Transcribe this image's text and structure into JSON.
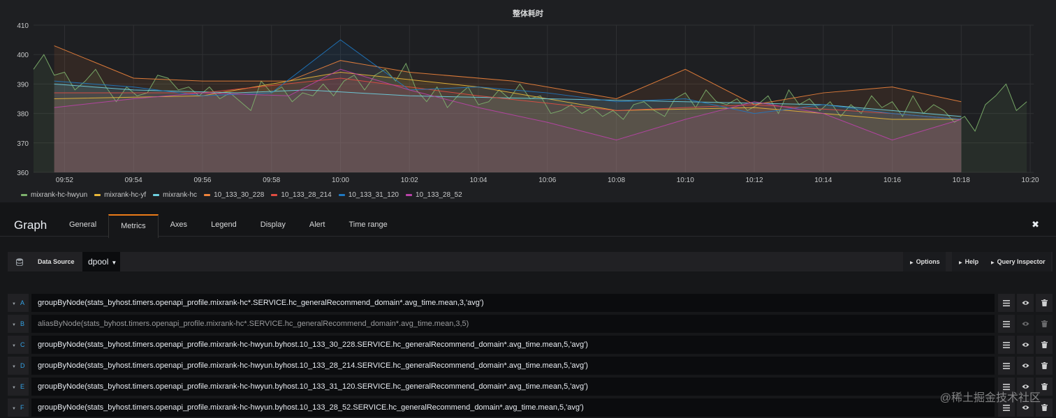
{
  "panel": {
    "title": "整体耗时"
  },
  "chart_data": {
    "type": "line",
    "title": "整体耗时",
    "ylim": [
      360,
      410
    ],
    "y_ticks": [
      "360",
      "370",
      "380",
      "390",
      "400",
      "410"
    ],
    "x_ticks": [
      "09:52",
      "09:54",
      "09:56",
      "09:58",
      "10:00",
      "10:02",
      "10:04",
      "10:06",
      "10:08",
      "10:10",
      "10:12",
      "10:14",
      "10:16",
      "10:18",
      "10:20"
    ],
    "x_range_minutes": [
      -8.9,
      20.1
    ],
    "grid": true,
    "legend_position": "bottom-left",
    "series": [
      {
        "name": "mixrank-hc-hwyun",
        "color": "#7eb26d",
        "x": [
          -8.9,
          -8.6,
          -8.3,
          -8.0,
          -7.7,
          -7.4,
          -7.1,
          -6.8,
          -6.5,
          -6.2,
          -5.9,
          -5.6,
          -5.3,
          -5.0,
          -4.7,
          -4.4,
          -4.1,
          -3.8,
          -3.5,
          -3.2,
          -2.9,
          -2.6,
          -2.3,
          -2.0,
          -1.7,
          -1.4,
          -1.1,
          -0.8,
          -0.5,
          -0.2,
          0.1,
          0.4,
          0.7,
          1.0,
          1.3,
          1.6,
          1.9,
          2.2,
          2.5,
          2.8,
          3.1,
          3.4,
          3.7,
          4.0,
          4.3,
          4.6,
          4.9,
          5.2,
          5.5,
          5.8,
          6.1,
          6.4,
          6.7,
          7.0,
          7.3,
          7.6,
          7.9,
          8.2,
          8.5,
          8.8,
          9.1,
          9.4,
          9.7,
          10.0,
          10.3,
          10.6,
          10.9,
          11.2,
          11.5,
          11.8,
          12.1,
          12.4,
          12.7,
          13.0,
          13.3,
          13.6,
          13.9,
          14.2,
          14.5,
          14.8,
          15.1,
          15.4,
          15.7,
          16.0,
          16.3,
          16.6,
          16.9,
          17.2,
          17.5,
          17.8,
          18.1,
          18.4,
          18.7,
          19.0,
          19.3,
          19.6,
          19.9
        ],
        "values": [
          395,
          400,
          393,
          394,
          388,
          391,
          395,
          389,
          384,
          389,
          386,
          387,
          393,
          392,
          388,
          389,
          386,
          389,
          385,
          387,
          384,
          381,
          391,
          387,
          389,
          384,
          387,
          386,
          390,
          386,
          391,
          393,
          388,
          393,
          395,
          391,
          397,
          388,
          384,
          389,
          382,
          386,
          389,
          383,
          384,
          388,
          385,
          390,
          385,
          386,
          380,
          381,
          383,
          380,
          382,
          379,
          381,
          378,
          383,
          384,
          381,
          379,
          385,
          387,
          382,
          388,
          384,
          383,
          385,
          381,
          383,
          386,
          380,
          388,
          383,
          385,
          381,
          384,
          379,
          383,
          380,
          386,
          382,
          384,
          379,
          386,
          380,
          383,
          381,
          377,
          379,
          374,
          383,
          386,
          390,
          381,
          384
        ]
      },
      {
        "name": "mixrank-hc-yf",
        "color": "#eab839",
        "x": [
          -8.3,
          -4.0,
          0.0,
          4.0,
          8.0,
          12.0,
          16.0,
          18.0
        ],
        "values": [
          385,
          386,
          394,
          389,
          381,
          382,
          378,
          378
        ]
      },
      {
        "name": "mixrank-hc",
        "color": "#6ed0e0",
        "x": [
          -8.3,
          -6.0,
          -3.0,
          -1.0,
          2.0,
          6.0,
          10.0,
          14.0,
          18.0
        ],
        "values": [
          390,
          388,
          387,
          388,
          386,
          385,
          384,
          383,
          379
        ]
      },
      {
        "name": "10_133_30_228",
        "color": "#ef843c",
        "x": [
          -8.3,
          -6.0,
          -4.0,
          -1.5,
          0.0,
          2.0,
          5.0,
          8.0,
          10.0,
          12.0,
          14.0,
          16.0,
          18.0
        ],
        "values": [
          403,
          392,
          391,
          391,
          398,
          394,
          391,
          385,
          395,
          383,
          387,
          389,
          384
        ]
      },
      {
        "name": "10_133_28_214",
        "color": "#e24d42",
        "x": [
          -8.3,
          -4.0,
          0.0,
          4.0,
          8.0,
          12.0,
          16.0,
          18.0
        ],
        "values": [
          387,
          387,
          392,
          386,
          381,
          383,
          380,
          378
        ]
      },
      {
        "name": "10_133_31_120",
        "color": "#1f78c1",
        "x": [
          -8.3,
          -6.0,
          -4.0,
          -2.0,
          0.0,
          2.0,
          4.0,
          6.0,
          8.0,
          10.0,
          12.0,
          14.0,
          16.0,
          18.0
        ],
        "values": [
          391,
          389,
          386,
          387,
          405,
          388,
          389,
          387,
          384,
          385,
          380,
          383,
          380,
          378
        ]
      },
      {
        "name": "10_133_28_52",
        "color": "#ba43a9",
        "x": [
          -8.3,
          -6.0,
          -4.0,
          -1.5,
          0.0,
          2.0,
          4.0,
          6.0,
          8.0,
          10.0,
          12.0,
          14.0,
          16.0,
          18.0
        ],
        "values": [
          382,
          385,
          387,
          386,
          395,
          388,
          382,
          377,
          371,
          378,
          384,
          380,
          371,
          378
        ]
      }
    ]
  },
  "legend": {
    "items": [
      {
        "label": "mixrank-hc-hwyun",
        "color": "#7eb26d"
      },
      {
        "label": "mixrank-hc-yf",
        "color": "#eab839"
      },
      {
        "label": "mixrank-hc",
        "color": "#6ed0e0"
      },
      {
        "label": "10_133_30_228",
        "color": "#ef843c"
      },
      {
        "label": "10_133_28_214",
        "color": "#e24d42"
      },
      {
        "label": "10_133_31_120",
        "color": "#1f78c1"
      },
      {
        "label": "10_133_28_52",
        "color": "#ba43a9"
      }
    ]
  },
  "editor": {
    "title": "Graph",
    "tabs": [
      "General",
      "Metrics",
      "Axes",
      "Legend",
      "Display",
      "Alert",
      "Time range"
    ],
    "active_tab": "Metrics",
    "close_label": "✖"
  },
  "datasource": {
    "label": "Data Source",
    "value": "dpool",
    "options_label": "Options",
    "help_label": "Help",
    "inspector_label": "Query Inspector"
  },
  "queries": [
    {
      "ref": "A",
      "disabled": false,
      "text": "groupByNode(stats_byhost.timers.openapi_profile.mixrank-hc*.SERVICE.hc_generalRecommend_domain*.avg_time.mean,3,'avg')"
    },
    {
      "ref": "B",
      "disabled": true,
      "text": "aliasByNode(stats_byhost.timers.openapi_profile.mixrank-hc*.SERVICE.hc_generalRecommend_domain*.avg_time.mean,3,5)"
    },
    {
      "ref": "C",
      "disabled": false,
      "text": "groupByNode(stats_byhost.timers.openapi_profile.mixrank-hc-hwyun.byhost.10_133_30_228.SERVICE.hc_generalRecommend_domain*.avg_time.mean,5,'avg')"
    },
    {
      "ref": "D",
      "disabled": false,
      "text": "groupByNode(stats_byhost.timers.openapi_profile.mixrank-hc-hwyun.byhost.10_133_28_214.SERVICE.hc_generalRecommend_domain*.avg_time.mean,5,'avg')"
    },
    {
      "ref": "E",
      "disabled": false,
      "text": "groupByNode(stats_byhost.timers.openapi_profile.mixrank-hc-hwyun.byhost.10_133_31_120.SERVICE.hc_generalRecommend_domain*.avg_time.mean,5,'avg')"
    },
    {
      "ref": "F",
      "disabled": false,
      "text": "groupByNode(stats_byhost.timers.openapi_profile.mixrank-hc-hwyun.byhost.10_133_28_52.SERVICE.hc_generalRecommend_domain*.avg_time.mean,5,'avg')"
    }
  ],
  "watermark": "@稀土掘金技术社区",
  "icons": {
    "menu": "hamburger-icon",
    "eye": "eye-icon",
    "trash": "trash-icon",
    "database": "database-icon",
    "caret": "caret-down-icon"
  }
}
